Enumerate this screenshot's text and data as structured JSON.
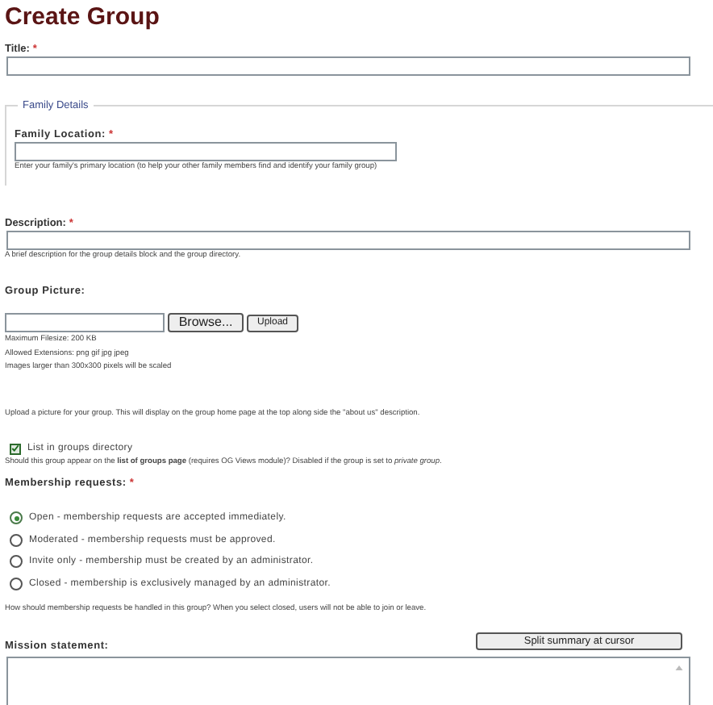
{
  "page": {
    "title": "Create Group"
  },
  "title_field": {
    "label": "Title:",
    "required": "*"
  },
  "family_details": {
    "legend": "Family Details",
    "location_field": {
      "label": "Family Location:",
      "required": "*",
      "help": "Enter your family's primary location (to help your other family members find and identify your family group)"
    }
  },
  "description_field": {
    "label": "Description:",
    "required": "*",
    "help": "A brief description for the group details block and the group directory."
  },
  "group_picture": {
    "label": "Group Picture:",
    "browse_button": "Browse...",
    "upload_button": "Upload",
    "info": [
      "Maximum Filesize: 200 KB",
      "Allowed Extensions: png gif jpg jpeg",
      "Images larger than 300x300 pixels will be scaled"
    ],
    "help": "Upload a picture for your group. This will display on the group home page at the top along side the \"about us\" description."
  },
  "list_in_directory": {
    "label": "List in groups directory",
    "checked": true,
    "help": "Should this group appear on the **list of groups page** (requires OG Views module)? Disabled if the group is set to *private group*."
  },
  "membership": {
    "label": "Membership requests:",
    "required": "*",
    "options": [
      {
        "label": "Open - membership requests are accepted immediately.",
        "selected": true
      },
      {
        "label": "Moderated - membership requests must be approved.",
        "selected": false
      },
      {
        "label": "Invite only - membership must be created by an administrator.",
        "selected": false
      },
      {
        "label": "Closed - membership is exclusively managed by an administrator.",
        "selected": false
      }
    ],
    "help": "How should membership requests be handled in this group? When you select closed, users will not be able to join or leave."
  },
  "mission_statement": {
    "label": "Mission statement:",
    "split_button": "Split summary at cursor"
  }
}
